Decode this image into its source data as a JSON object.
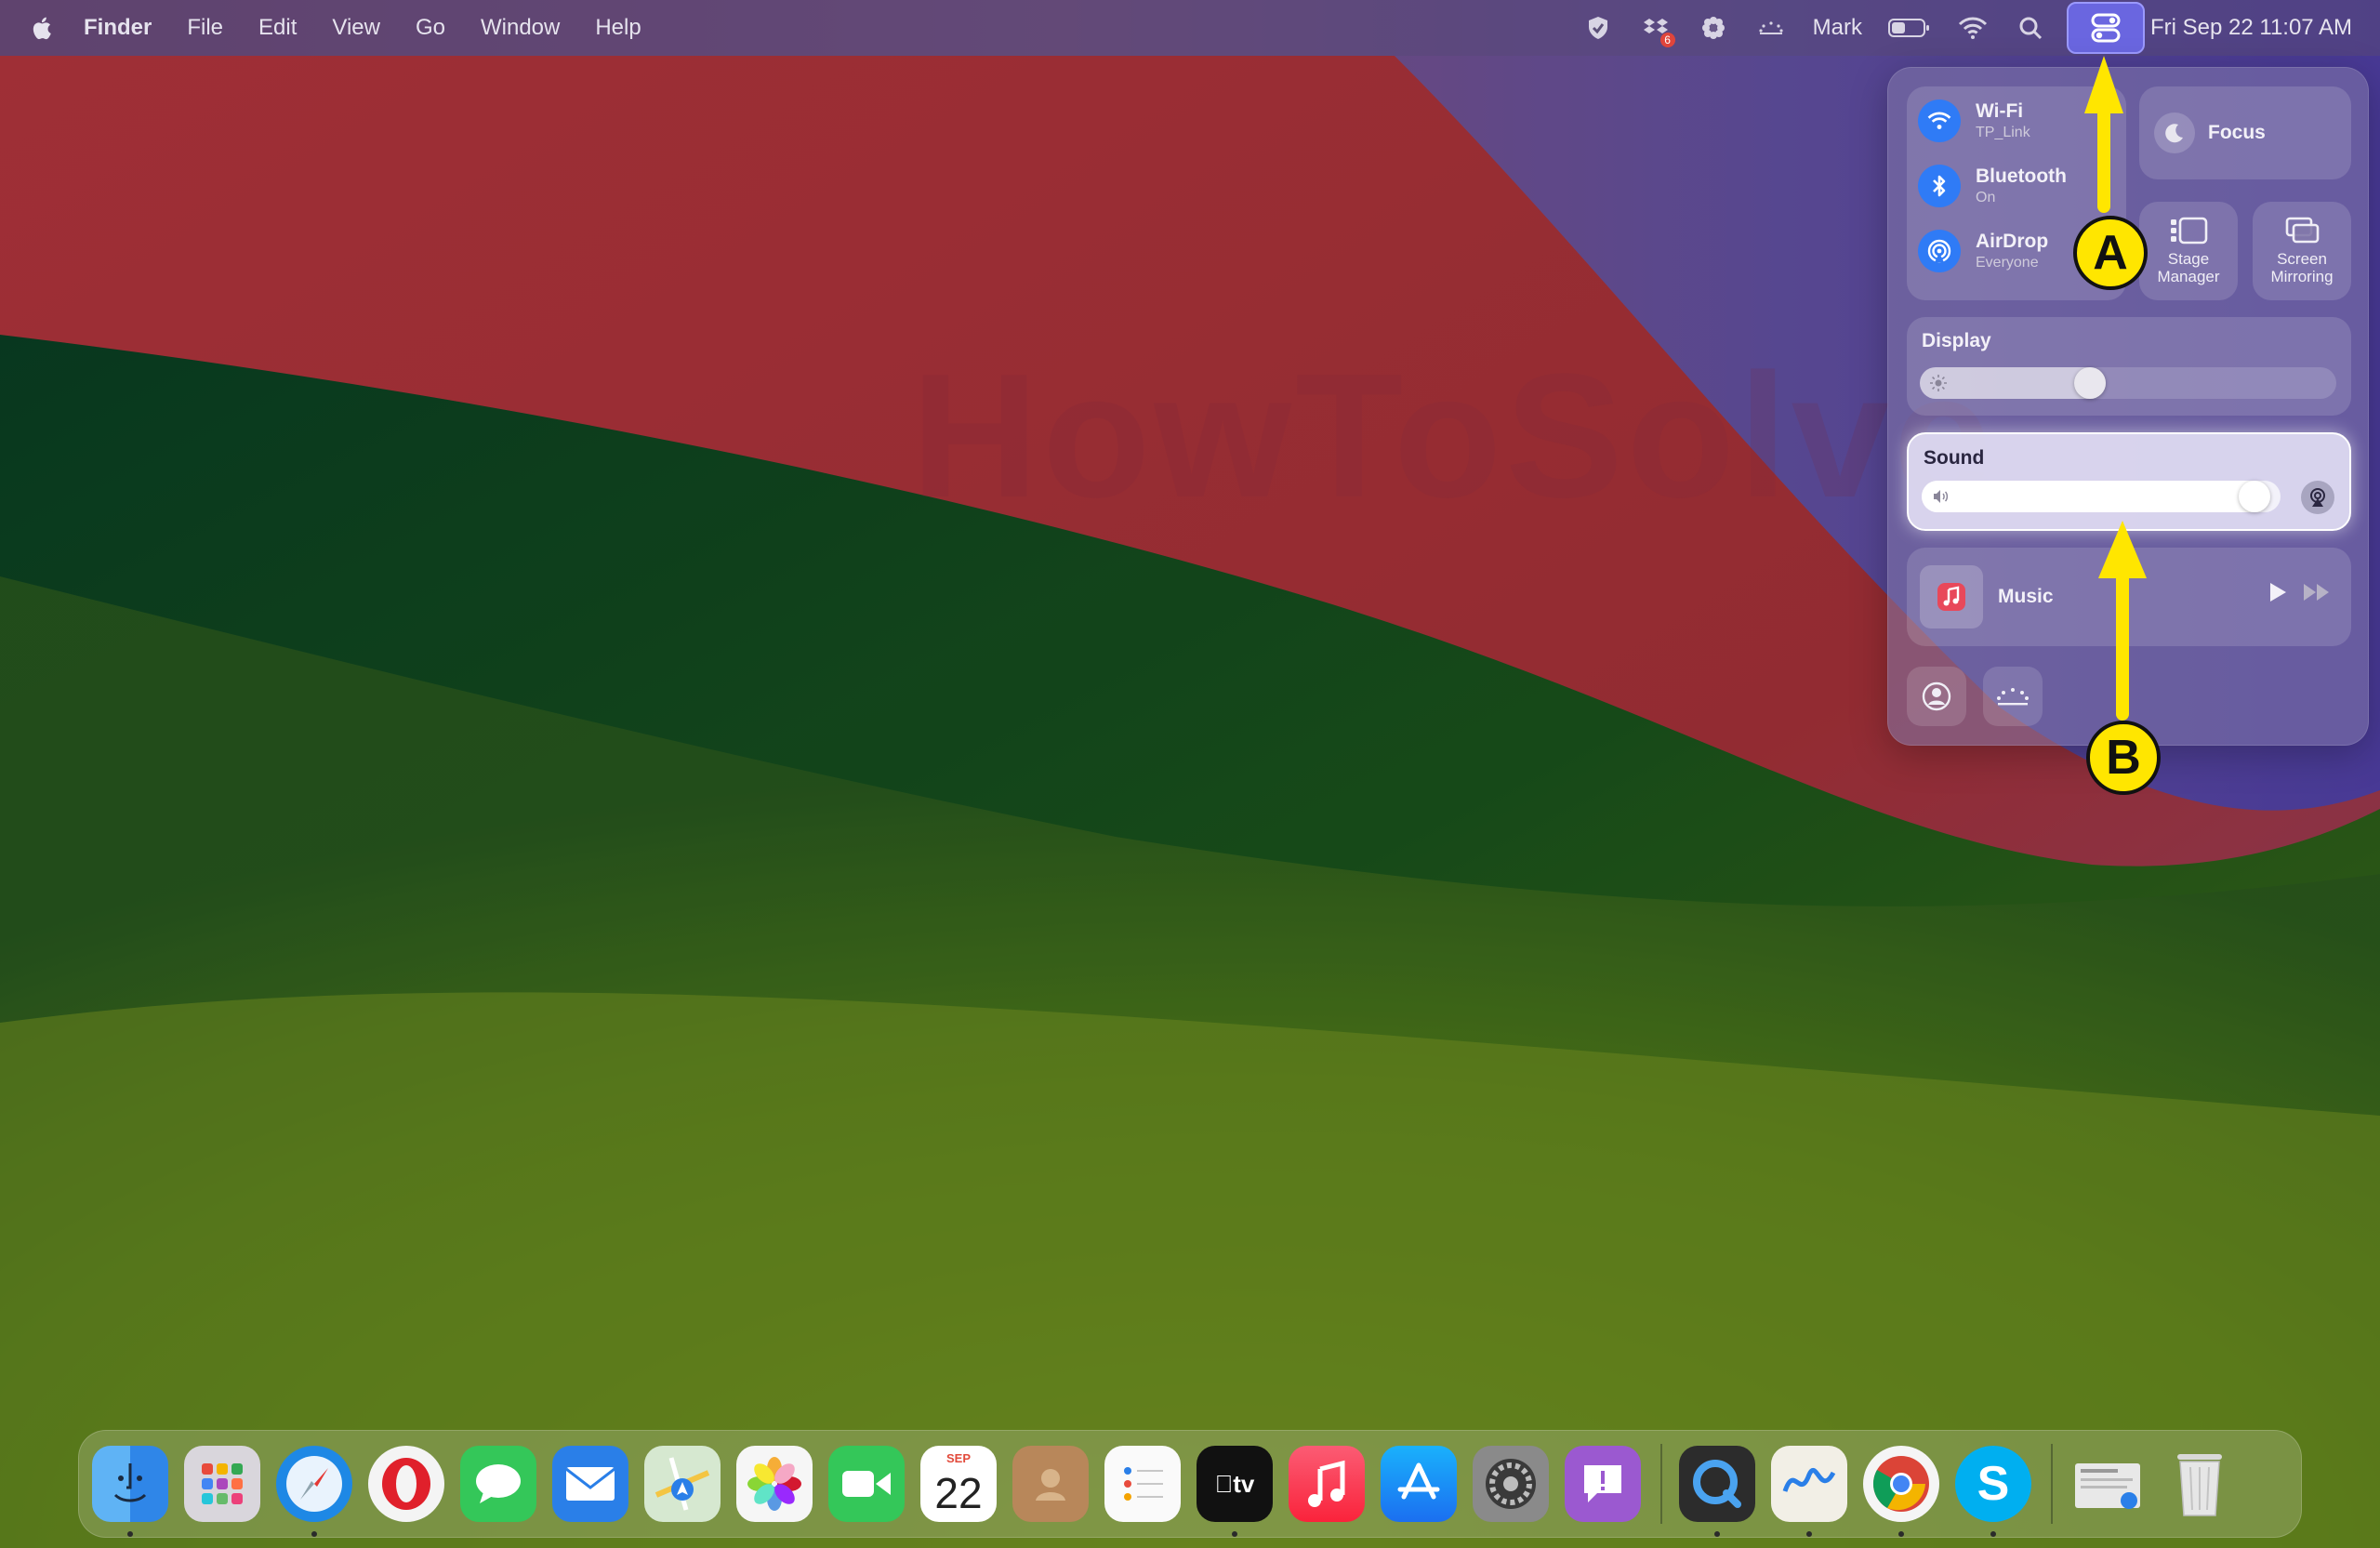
{
  "menubar": {
    "app_name": "Finder",
    "menus": [
      "File",
      "Edit",
      "View",
      "Go",
      "Window",
      "Help"
    ],
    "user_name": "Mark",
    "clock": "Fri Sep 22  11:07 AM",
    "dropbox_badge": "6",
    "battery_level": 0.45
  },
  "wallpaper": {
    "watermark": "HowToSolve"
  },
  "control_center": {
    "wifi": {
      "title": "Wi-Fi",
      "subtitle": "TP_Link"
    },
    "bluetooth": {
      "title": "Bluetooth",
      "subtitle": "On"
    },
    "airdrop": {
      "title": "AirDrop",
      "subtitle": "Everyone"
    },
    "focus": {
      "label": "Focus"
    },
    "stage_manager": {
      "line1": "Stage",
      "line2": "Manager"
    },
    "screen_mirroring": {
      "line1": "Screen",
      "line2": "Mirroring"
    },
    "display": {
      "title": "Display",
      "brightness": 0.4
    },
    "sound": {
      "title": "Sound",
      "volume": 0.97
    },
    "music": {
      "label": "Music"
    }
  },
  "annotations": {
    "marker_a": "A",
    "marker_b": "B"
  },
  "dock": {
    "calendar_month": "SEP",
    "calendar_day": "22",
    "apple_tv_label": "tv",
    "skype_letter": "S"
  },
  "colors": {
    "accent_blue": "#2f7bf6",
    "control_center_button": "#6a66e0",
    "annotation_yellow": "#ffe600"
  }
}
